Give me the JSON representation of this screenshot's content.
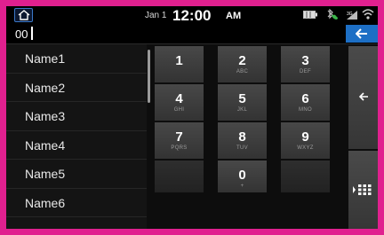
{
  "status_bar": {
    "date": "Jan 1",
    "time": "12:00",
    "ampm": "AM",
    "icons": [
      "home-icon",
      "battery-icon",
      "bluetooth-phone-icon",
      "signal-icon",
      "wifi-icon"
    ]
  },
  "input": {
    "value": "00"
  },
  "contacts": [
    "Name1",
    "Name2",
    "Name3",
    "Name4",
    "Name5",
    "Name6"
  ],
  "keypad": [
    {
      "num": "1",
      "sub": ""
    },
    {
      "num": "2",
      "sub": "ABC"
    },
    {
      "num": "3",
      "sub": "DEF"
    },
    {
      "num": "4",
      "sub": "GHI"
    },
    {
      "num": "5",
      "sub": "JKL"
    },
    {
      "num": "6",
      "sub": "MNO"
    },
    {
      "num": "7",
      "sub": "PQRS"
    },
    {
      "num": "8",
      "sub": "TUV"
    },
    {
      "num": "9",
      "sub": "WXYZ"
    },
    {
      "num": "",
      "sub": ""
    },
    {
      "num": "0",
      "sub": "+"
    },
    {
      "num": "",
      "sub": ""
    }
  ],
  "colors": {
    "accent": "#1d6fc5",
    "frame": "#e0208f"
  }
}
